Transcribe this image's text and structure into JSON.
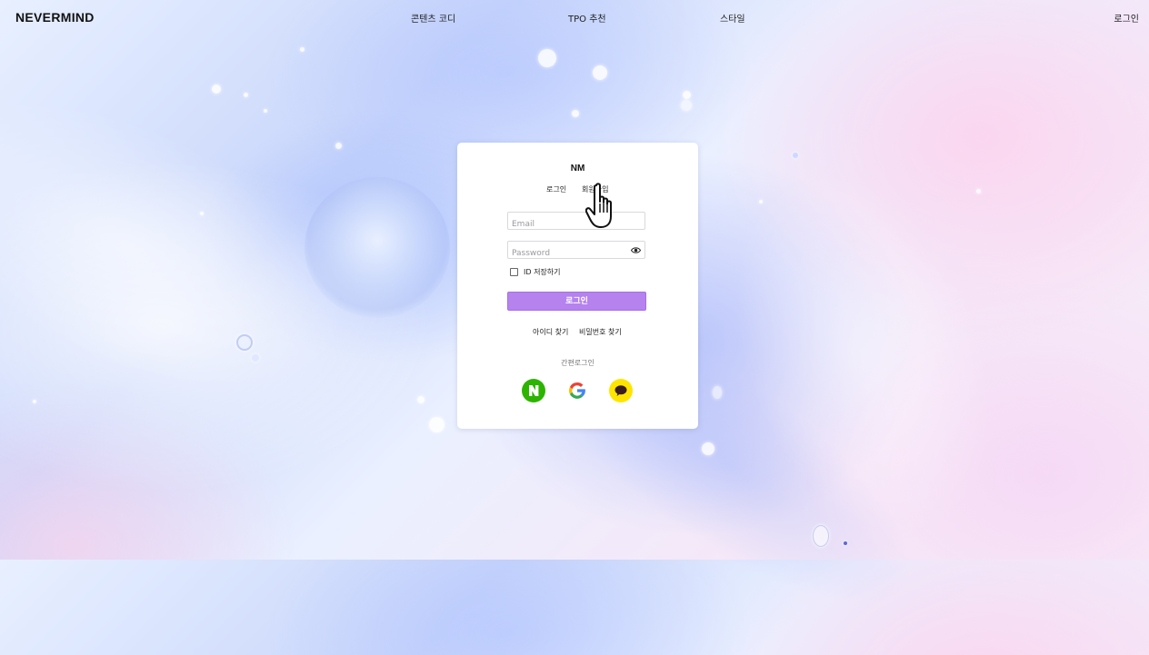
{
  "header": {
    "logo": "NEVERMIND",
    "nav": [
      "콘텐츠 코디",
      "TPO 추천",
      "스타일"
    ],
    "login": "로그인"
  },
  "card": {
    "title": "NM",
    "tabs": {
      "login": "로그인",
      "signup": "회원가입"
    },
    "email": {
      "placeholder": "Email",
      "value": ""
    },
    "password": {
      "placeholder": "Password",
      "value": "",
      "icon": "eye-icon"
    },
    "remember_id": {
      "label": "ID 저장하기",
      "checked": false
    },
    "login_button": "로그인",
    "find_id": "아이디 찾기",
    "find_password": "비밀번호 찾기",
    "simple_login": "간편로그인",
    "social": [
      {
        "name": "naver",
        "icon": "naver-icon",
        "color": "#2db400"
      },
      {
        "name": "google",
        "icon": "google-icon"
      },
      {
        "name": "kakao",
        "icon": "kakao-icon",
        "color": "#fee500"
      }
    ]
  },
  "colors": {
    "accent": "#b582ee",
    "naver": "#2db400",
    "kakao": "#fee500"
  }
}
